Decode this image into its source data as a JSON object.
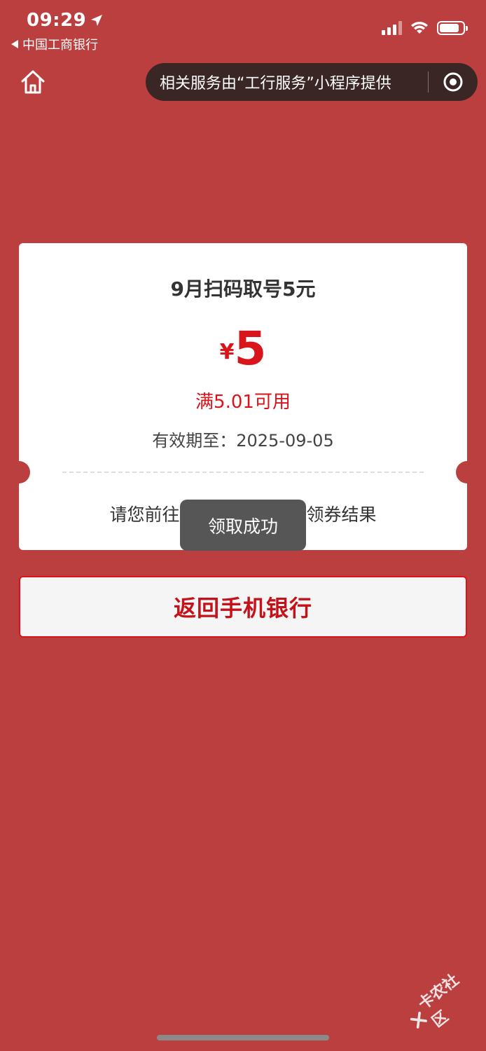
{
  "status_bar": {
    "time": "09:29",
    "back_app": "中国工商银行",
    "battery_level": 0.85
  },
  "nav": {
    "capsule_text": "相关服务由“工行服务”小程序提供"
  },
  "coupon": {
    "title": "9月扫码取号5元",
    "currency": "¥",
    "amount": "5",
    "condition": "满5.01可用",
    "validity": "有效期至：2025-09-05",
    "hint": "请您前往“                  看领券结果"
  },
  "toast": {
    "text": "领取成功"
  },
  "actions": {
    "return_label": "返回手机银行"
  },
  "watermark": {
    "text": "卡农社区"
  },
  "colors": {
    "background": "#bc3f3f",
    "accent": "#d9141b"
  }
}
